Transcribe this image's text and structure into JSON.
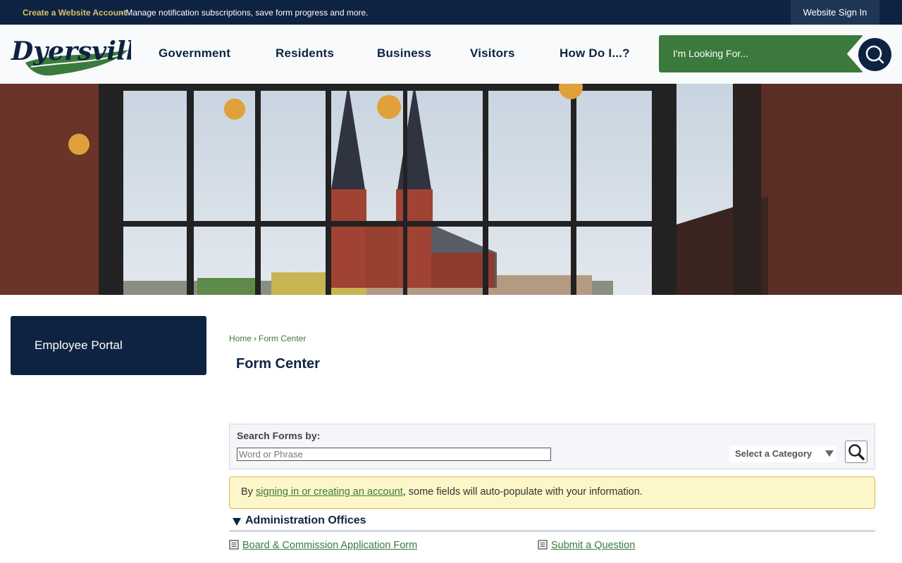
{
  "topbar": {
    "create_account": "Create a Website Account",
    "description": " - Manage notification subscriptions, save form progress and more.",
    "sign_in": "Website Sign In"
  },
  "header": {
    "logo_text": "Dyersville",
    "nav": [
      "Government",
      "Residents",
      "Business",
      "Visitors",
      "How Do I...?"
    ],
    "search_placeholder": "I'm Looking For..."
  },
  "hero": {
    "alt": "View of church spires through large windows"
  },
  "sidebar": {
    "employee_portal": "Employee Portal"
  },
  "breadcrumb": {
    "home": "Home",
    "separator": "›",
    "current": "Form Center"
  },
  "page_title": "Form Center",
  "search_forms": {
    "label": "Search Forms by:",
    "placeholder": "Word or Phrase",
    "category": "Select a Category"
  },
  "notice": {
    "before": "By ",
    "link": "signing in or creating an account",
    "after": ", some fields will auto-populate with your information."
  },
  "section": {
    "title": "Administration Offices",
    "forms": [
      "Board & Commission Application Form",
      "Submit a Question"
    ]
  },
  "colors": {
    "navy": "#0e2341",
    "green": "#3b7a3c",
    "gold": "#d9c16a"
  }
}
